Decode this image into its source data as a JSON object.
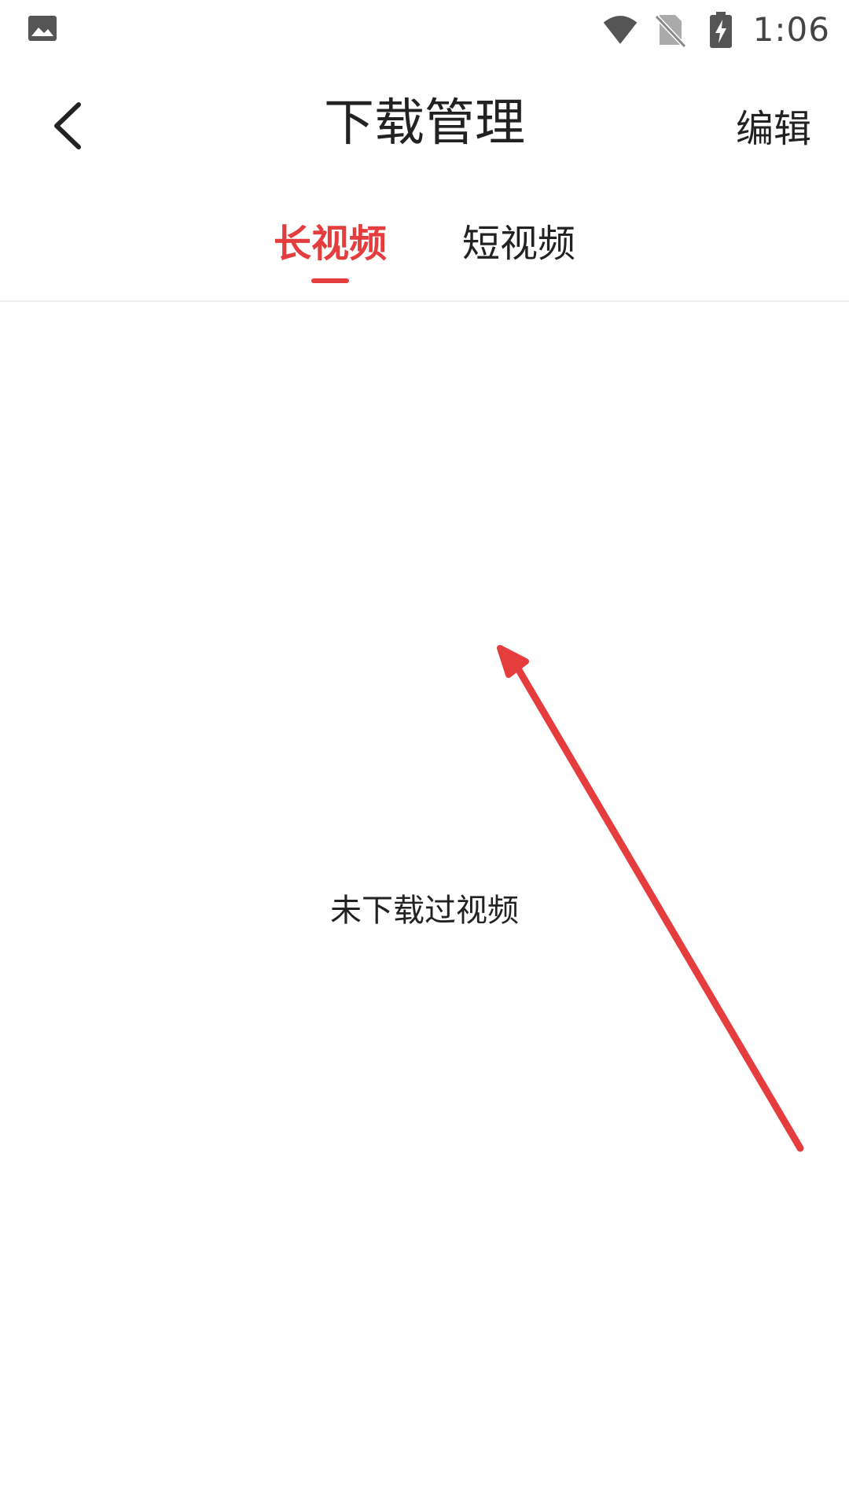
{
  "status_bar": {
    "time": "1:06",
    "left_icon": "image-icon",
    "icons": [
      "wifi-icon",
      "no-sim-icon",
      "battery-charging-icon"
    ]
  },
  "app_bar": {
    "title": "下载管理",
    "edit_label": "编辑",
    "back_icon": "chevron-left-icon"
  },
  "tabs": [
    {
      "label": "长视频",
      "active": true
    },
    {
      "label": "短视频",
      "active": false
    }
  ],
  "content": {
    "empty_message": "未下载过视频"
  },
  "colors": {
    "accent": "#e53d3d",
    "text": "#222222",
    "status_icons": "#555555",
    "divider": "#eeeeee"
  }
}
